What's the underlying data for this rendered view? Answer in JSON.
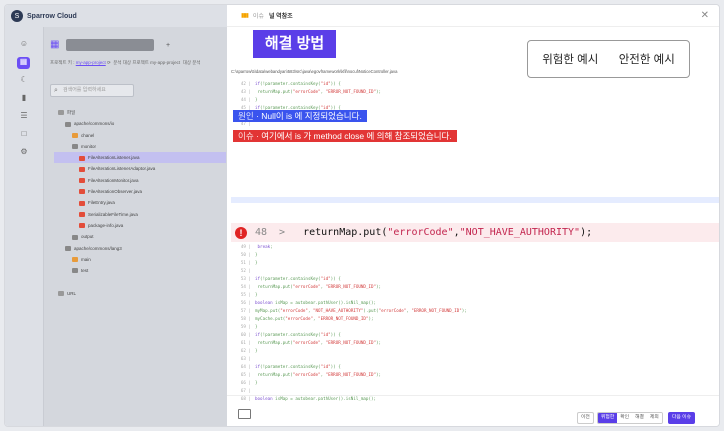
{
  "brand": {
    "name": "Sparrow Cloud"
  },
  "sidebar": {
    "project_add": "+",
    "crumb_project_label": "프로젝트 키",
    "crumb_project_key": "my-app-project",
    "crumb_analysis_label": "분석 대상 프로젝트",
    "crumb_analysis_value": "my-app-project",
    "crumb_tail": "대상 분석",
    "search_placeholder": "검색어를 입력하세요",
    "tree": [
      {
        "label": "파일",
        "indent": 0,
        "color": "#999"
      },
      {
        "label": "apache/commons/io",
        "indent": 1,
        "color": "#888"
      },
      {
        "label": "chanel",
        "indent": 2,
        "color": "#e89b3a"
      },
      {
        "label": "monitor",
        "indent": 2,
        "color": "#888"
      },
      {
        "label": "FileAlterationListener.java",
        "indent": 3,
        "color": "#e34d3a",
        "selected": true
      },
      {
        "label": "FileAlterationListenerAdaptor.java",
        "indent": 3,
        "color": "#e34d3a"
      },
      {
        "label": "FileAlterationMonitor.java",
        "indent": 3,
        "color": "#e34d3a"
      },
      {
        "label": "FileAlterationObserver.java",
        "indent": 3,
        "color": "#e34d3a"
      },
      {
        "label": "FileEntry.java",
        "indent": 3,
        "color": "#e34d3a"
      },
      {
        "label": "SerializableFileTime.java",
        "indent": 3,
        "color": "#e34d3a"
      },
      {
        "label": "package-info.java",
        "indent": 3,
        "color": "#e34d3a"
      },
      {
        "label": "output",
        "indent": 2,
        "color": "#888"
      },
      {
        "label": "apache/commons/lang3",
        "indent": 1,
        "color": "#888"
      },
      {
        "label": "main",
        "indent": 2,
        "color": "#e89b3a"
      },
      {
        "label": "test",
        "indent": 2,
        "color": "#888"
      },
      {
        "label": "",
        "indent": 0,
        "color": ""
      },
      {
        "label": "URL",
        "indent": 0,
        "color": "#999"
      }
    ]
  },
  "modal": {
    "header_label": "이슈",
    "header_title": "널 역참조",
    "solution_title": "해결 방법",
    "toggle_bad": "위험한 예시",
    "toggle_good": "안전한 예시",
    "file_path": "C:\\sparrow\\5\\data\\webandyan\\583\\src\\java\\egovframework\\kfil\\nocul\\NoticeController.java",
    "cause_tag_label": "원인",
    "cause_tag_text": "Null이 is 에 지정되었습니다.",
    "issue_tag_label": "이슈",
    "issue_tag_text": "여기에서 is 가 method close 에 의해 참조되었습니다.",
    "error_line_no": "48",
    "error_line_arrow": ">",
    "error_code_pre": "returnMap.put(",
    "error_code_s1": "\"errorCode\"",
    "error_code_mid": ", ",
    "error_code_s2": "\"NOT_HAVE_AUTHORITY\"",
    "error_code_post": ");",
    "code_lines": [
      {
        "n": "42",
        "t": "if(!parameter.containsKey(\"id\")) {"
      },
      {
        "n": "43",
        "t": "  returnMap.put(\"errorCode\", \"ERROR_NOT_FOUND_ID\");"
      },
      {
        "n": "44",
        "t": "}"
      },
      {
        "n": "45",
        "t": "if(!parameter.containsKey(\"id\")) {"
      },
      {
        "n": "46",
        "t": ""
      },
      {
        "n": "47",
        "t": ""
      },
      {
        "n": "49",
        "t": "  break;"
      },
      {
        "n": "50",
        "t": "}"
      },
      {
        "n": "51",
        "t": "}"
      },
      {
        "n": "52",
        "t": ""
      },
      {
        "n": "53",
        "t": "if(!parameter.containsKey(\"id\")) {"
      },
      {
        "n": "54",
        "t": "  returnMap.put(\"errorCode\", \"ERROR_NOT_FOUND_ID\");"
      },
      {
        "n": "55",
        "t": "}"
      },
      {
        "n": "56",
        "t": "boolean isMap = autobear.pathUser().isNil_map();"
      },
      {
        "n": "57",
        "t": "myMap.put(\"errorCode\", \"NOT_HAVE_AUTHORITY\").put(\"errorCode\", \"ERROR_NOT_FOUND_ID\");"
      },
      {
        "n": "58",
        "t": "myCache.put(\"errorCode\", \"ERROR_NOT_FOUND_ID\");"
      },
      {
        "n": "59",
        "t": "}"
      },
      {
        "n": "60",
        "t": "if(!parameter.containsKey(\"id\")) {"
      },
      {
        "n": "61",
        "t": "  returnMap.put(\"errorCode\", \"ERROR_NOT_FOUND_ID\");"
      },
      {
        "n": "62",
        "t": "}"
      },
      {
        "n": "63",
        "t": ""
      },
      {
        "n": "64",
        "t": "if(!parameter.containsKey(\"id\")) {"
      },
      {
        "n": "65",
        "t": "  returnMap.put(\"errorCode\", \"ERROR_NOT_FOUND_ID\");"
      },
      {
        "n": "66",
        "t": "}"
      },
      {
        "n": "67",
        "t": ""
      },
      {
        "n": "68",
        "t": "boolean isMap = autobear.pathUser().isNil_map();"
      },
      {
        "n": "69",
        "t": "myMap.put(\"errorCode\", \"NOT_HAVE_AUTHORITY\").put(\"errorCode\", \"ERROR_NOT_FOUND_ID\");"
      },
      {
        "n": "70",
        "t": "myCache.put(\"errorCode\", \"ERROR_NOT_FOUND_ID\");"
      },
      {
        "n": "71",
        "t": "if(!parameter.containsKey(\"id\")) {"
      },
      {
        "n": "72",
        "t": "  returnMap.put(\"errorCode\", \"ERROR_NOT_FOUND_ID\");"
      },
      {
        "n": "73",
        "t": "}"
      },
      {
        "n": "74",
        "t": ""
      },
      {
        "n": "75",
        "t": "if(!parameter.containsKey(\"id\")) {"
      },
      {
        "n": "76",
        "t": "  returnMap.put(\"errorCode\", \"ERROR_NOT_FOUND_ID\");"
      }
    ],
    "footer": {
      "prev": "이전",
      "pages": [
        "위험한",
        "확인",
        "해결",
        "제외"
      ],
      "active_page": 0,
      "next": "다음 이슈"
    }
  }
}
